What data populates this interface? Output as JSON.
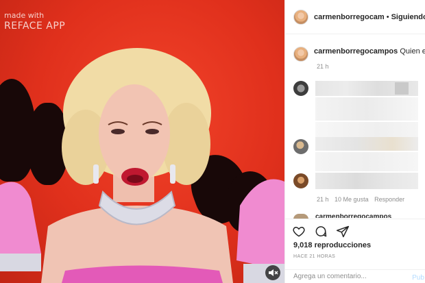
{
  "watermark": {
    "line1": "made with",
    "line2": "REFACE APP"
  },
  "header": {
    "username": "carmenborregocam",
    "separator": "•",
    "follow_state": "Siguiendo"
  },
  "caption": {
    "username": "carmenborregocampos",
    "text": "Quien es",
    "time": "21 h"
  },
  "comment_meta": {
    "time": "21 h",
    "likes": "10 Me gusta",
    "reply": "Responder"
  },
  "partial_comment_username": "carmenborregocampos",
  "stats": {
    "views": "9,018 reproducciones",
    "posted_ago": "HACE 21 HORAS"
  },
  "comment_box": {
    "placeholder": "Agrega un comentario...",
    "post_label": "Pub"
  },
  "icons": {
    "like": "heart-icon",
    "comment": "comment-icon",
    "share": "share-icon",
    "mute": "speaker-muted-icon"
  },
  "colors": {
    "background_red": "#e0301c",
    "link_blue": "#b3dbff",
    "text_dark": "#262626",
    "text_gray": "#8e8e8e"
  }
}
